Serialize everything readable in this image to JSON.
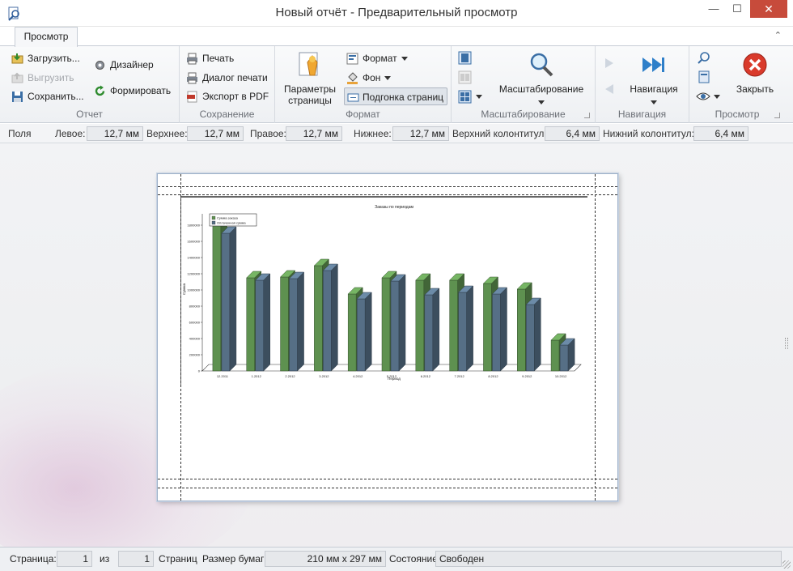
{
  "window": {
    "title": "Новый отчёт - Предварительный просмотр",
    "minimize_glyph": "—",
    "maximize_glyph": "☐",
    "close_glyph": "✕"
  },
  "ribbon_tab": "Просмотр",
  "collapse_glyph": "⌃",
  "groups": {
    "report": {
      "label": "Отчет",
      "load": "Загрузить...",
      "unload": "Выгрузить",
      "save": "Сохранить...",
      "designer": "Дизайнер",
      "generate": "Формировать"
    },
    "saving": {
      "label": "Сохранение",
      "print": "Печать",
      "print_dialog": "Диалог печати",
      "export_pdf": "Экспорт в PDF"
    },
    "format": {
      "label": "Формат",
      "page_params": "Параметры страницы",
      "format": "Формат",
      "background": "Фон",
      "fit_pages": "Подгонка страниц"
    },
    "scaling": {
      "label": "Масштабирование",
      "scaling_btn": "Масштабирование"
    },
    "navigation": {
      "label": "Навигация",
      "nav_btn": "Навигация"
    },
    "view": {
      "label": "Просмотр",
      "close": "Закрыть"
    }
  },
  "margins": {
    "fields": "Поля",
    "left_label": "Левое:",
    "left_value": "12,7 мм",
    "top_label": "Верхнее:",
    "top_value": "12,7 мм",
    "right_label": "Правое:",
    "right_value": "12,7 мм",
    "bottom_label": "Нижнее:",
    "bottom_value": "12,7 мм",
    "header_label": "Верхний колонтитул:",
    "header_value": "6,4 мм",
    "footer_label": "Нижний колонтитул:",
    "footer_value": "6,4 мм"
  },
  "chart_data": {
    "type": "bar",
    "title": "Заказы по периодам",
    "xlabel": "Период",
    "ylabel": "Сумма",
    "ylim": [
      0,
      1800000
    ],
    "yticks": [
      "0",
      "200000",
      "400000",
      "600000",
      "800000",
      "1000000",
      "1200000",
      "1400000",
      "1600000",
      "1800000"
    ],
    "categories": [
      "12.2011",
      "1.2012",
      "2.2012",
      "3.2012",
      "4.2012",
      "5.2012",
      "6.2012",
      "7.2012",
      "8.2012",
      "9.2012",
      "10.2012"
    ],
    "series": [
      {
        "name": "Сумма заказа",
        "color": "#5e9150",
        "values": [
          1800000,
          1150000,
          1160000,
          1300000,
          950000,
          1150000,
          1120000,
          1120000,
          1080000,
          1010000,
          380000
        ]
      },
      {
        "name": "Оплаченная сумма",
        "color": "#566f86",
        "values": [
          1700000,
          1120000,
          1140000,
          1240000,
          890000,
          1110000,
          940000,
          970000,
          950000,
          820000,
          320000
        ]
      }
    ],
    "legend_position": "top-left",
    "grid": false
  },
  "status": {
    "page_label": "Страница:",
    "page_value": "1",
    "of_label": "из",
    "total_value": "1",
    "pages_label": "Страниц",
    "paper_label": "Размер бумаги",
    "paper_value": "210 мм x 297 мм",
    "state_label": "Состояние",
    "state_value": "Свободен"
  }
}
